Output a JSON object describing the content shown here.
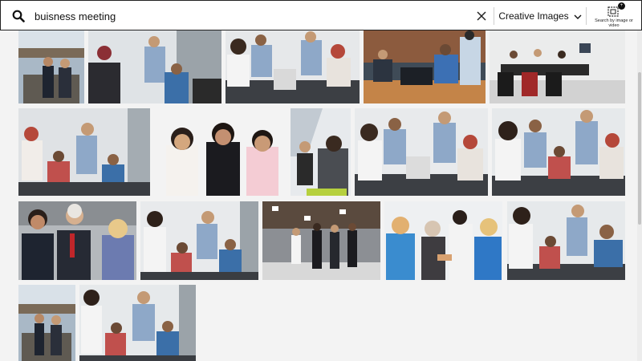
{
  "search": {
    "query": "buisness meeting",
    "placeholder": ""
  },
  "filters": {
    "image_type": "Creative Images"
  },
  "search_by_image": {
    "label": "Search by image or video",
    "badge": "+"
  },
  "colors": {
    "background": "#f3f3f3",
    "searchbar_border": "#222222",
    "accent_dark": "#111111"
  },
  "icons": [
    "search-icon",
    "clear-icon",
    "chevron-down-icon",
    "camera-search-icon"
  ]
}
